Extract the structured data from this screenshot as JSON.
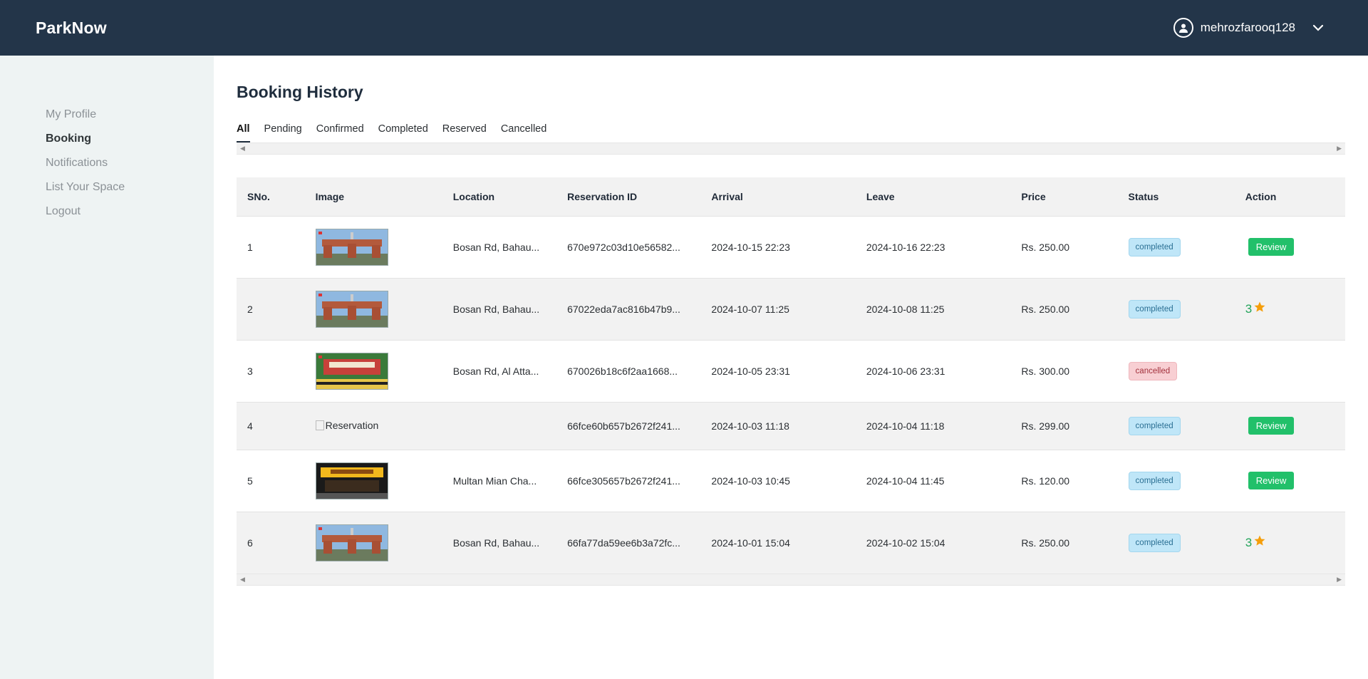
{
  "header": {
    "brand": "ParkNow",
    "username": "mehrozfarooq128"
  },
  "sidebar": {
    "items": [
      {
        "label": "My Profile",
        "active": false
      },
      {
        "label": "Booking",
        "active": true
      },
      {
        "label": "Notifications",
        "active": false
      },
      {
        "label": "List Your Space",
        "active": false
      },
      {
        "label": "Logout",
        "active": false
      }
    ]
  },
  "main": {
    "title": "Booking History",
    "tabs": [
      "All",
      "Pending",
      "Confirmed",
      "Completed",
      "Reserved",
      "Cancelled"
    ],
    "active_tab": "All"
  },
  "table": {
    "columns": [
      "SNo.",
      "Image",
      "Location",
      "Reservation ID",
      "Arrival",
      "Leave",
      "Price",
      "Status",
      "Action"
    ],
    "rows": [
      {
        "sno": "1",
        "image": "gate",
        "location": "Bosan Rd, Bahau...",
        "rid": "670e972c03d10e56582...",
        "arrival": "2024-10-15 22:23",
        "leave": "2024-10-16 22:23",
        "price": "Rs. 250.00",
        "status": "completed",
        "action": "Review"
      },
      {
        "sno": "2",
        "image": "gate",
        "location": "Bosan Rd, Bahau...",
        "rid": "67022eda7ac816b47b9...",
        "arrival": "2024-10-07 11:25",
        "leave": "2024-10-08 11:25",
        "price": "Rs. 250.00",
        "status": "completed",
        "action": "3"
      },
      {
        "sno": "3",
        "image": "market",
        "location": "Bosan Rd, Al Atta...",
        "rid": "670026b18c6f2aa1668...",
        "arrival": "2024-10-05 23:31",
        "leave": "2024-10-06 23:31",
        "price": "Rs. 300.00",
        "status": "cancelled",
        "action": ""
      },
      {
        "sno": "4",
        "image": "broken",
        "image_alt": "Reservation",
        "location": "",
        "rid": "66fce60b657b2672f241...",
        "arrival": "2024-10-03 11:18",
        "leave": "2024-10-04 11:18",
        "price": "Rs. 299.00",
        "status": "completed",
        "action": "Review"
      },
      {
        "sno": "5",
        "image": "cheezious",
        "location": "Multan Mian Cha...",
        "rid": "66fce305657b2672f241...",
        "arrival": "2024-10-03 10:45",
        "leave": "2024-10-04 11:45",
        "price": "Rs. 120.00",
        "status": "completed",
        "action": "Review"
      },
      {
        "sno": "6",
        "image": "gate",
        "location": "Bosan Rd, Bahau...",
        "rid": "66fa77da59ee6b3a72fc...",
        "arrival": "2024-10-01 15:04",
        "leave": "2024-10-02 15:04",
        "price": "Rs. 250.00",
        "status": "completed",
        "action": "3"
      }
    ]
  },
  "colors": {
    "header_bg": "#233549",
    "sidebar_bg": "#eef3f3",
    "review_btn": "#22c06a",
    "star": "#f59e0b"
  }
}
